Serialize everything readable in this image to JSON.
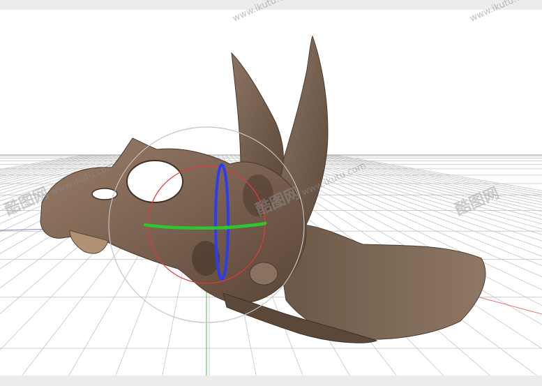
{
  "viewport": {
    "background": "#ffffff",
    "grid_color": "#bdbdbd",
    "horizon_color": "#9a9a9a"
  },
  "model": {
    "subject": "triceratops-skull-scan",
    "bone_dark": "#5a4636",
    "bone_mid": "#7d6552",
    "bone_light": "#a08670"
  },
  "gizmo": {
    "outer_ring_color": "#c4c4c4",
    "x_ring_color": "#e03a3a",
    "y_ring_color": "#2ec62e",
    "z_ring_color": "#2a3ef0",
    "x_axis_color": "#e05050",
    "y_axis_color": "#3cc03c",
    "z_axis_color": "#5060e0"
  },
  "watermark": {
    "text_cn": "酷图网",
    "text_url": "www.ikutu.com"
  }
}
